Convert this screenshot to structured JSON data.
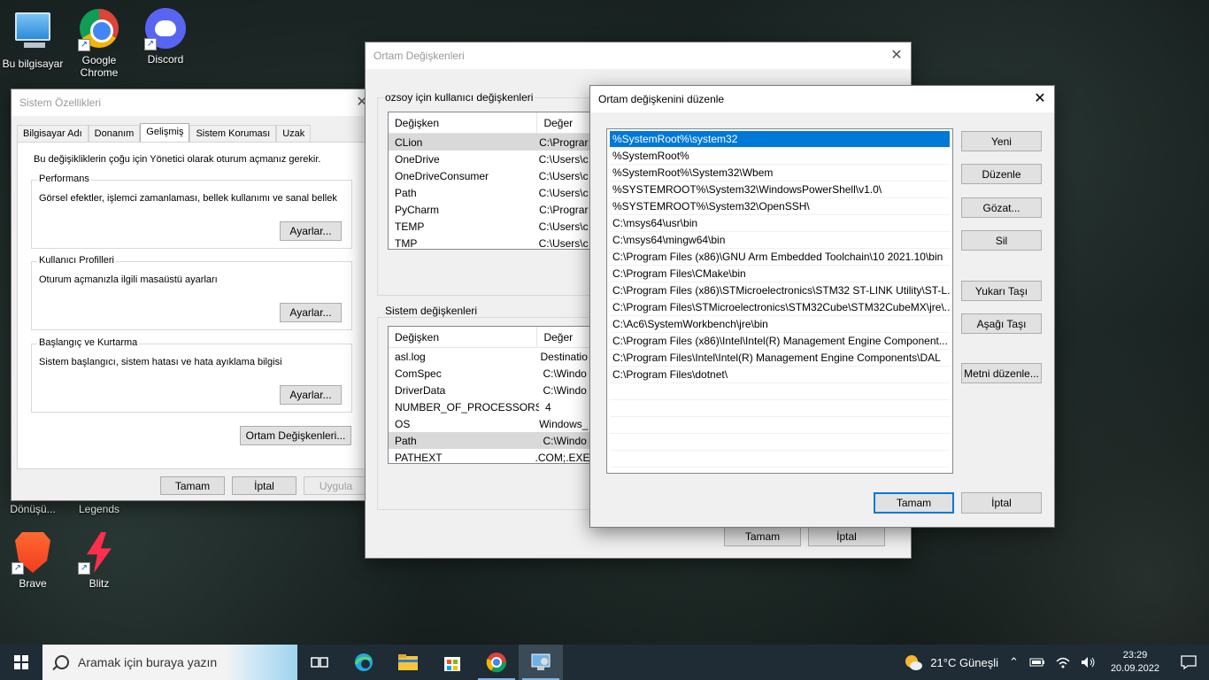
{
  "desktop": {
    "icons": [
      {
        "label": "Bu bilgisayar",
        "icon": "computer-icon"
      },
      {
        "label": "Google Chrome",
        "icon": "chrome-icon"
      },
      {
        "label": "Discord",
        "icon": "discord-icon"
      },
      {
        "label": "Dönüşü...",
        "icon": "app-icon"
      },
      {
        "label": "Legends",
        "icon": "app-icon"
      },
      {
        "label": "Brave",
        "icon": "brave-icon"
      },
      {
        "label": "Blitz",
        "icon": "blitz-icon"
      }
    ]
  },
  "system_properties": {
    "title": "Sistem Özellikleri",
    "tabs": [
      "Bilgisayar Adı",
      "Donanım",
      "Gelişmiş",
      "Sistem Koruması",
      "Uzak"
    ],
    "active_tab": "Gelişmiş",
    "admin_note": "Bu değişikliklerin çoğu için Yönetici olarak oturum açmanız gerekir.",
    "groups": [
      {
        "label": "Performans",
        "text": "Görsel efektler, işlemci zamanlaması, bellek kullanımı ve sanal bellek",
        "button": "Ayarlar..."
      },
      {
        "label": "Kullanıcı Profilleri",
        "text": "Oturum açmanızla ilgili masaüstü ayarları",
        "button": "Ayarlar..."
      },
      {
        "label": "Başlangıç ve Kurtarma",
        "text": "Sistem başlangıcı, sistem hatası ve hata ayıklama bilgisi",
        "button": "Ayarlar..."
      }
    ],
    "env_button": "Ortam Değişkenleri...",
    "ok": "Tamam",
    "cancel": "İptal",
    "apply": "Uygula"
  },
  "env_vars": {
    "title": "Ortam Değişkenleri",
    "user_section": "ozsoy için kullanıcı değişkenleri",
    "system_section": "Sistem değişkenleri",
    "col_var": "Değişken",
    "col_val": "Değer",
    "user_rows": [
      {
        "name": "CLion",
        "value": "C:\\Prograr"
      },
      {
        "name": "OneDrive",
        "value": "C:\\Users\\c"
      },
      {
        "name": "OneDriveConsumer",
        "value": "C:\\Users\\c"
      },
      {
        "name": "Path",
        "value": "C:\\Users\\c"
      },
      {
        "name": "PyCharm",
        "value": "C:\\Prograr"
      },
      {
        "name": "TEMP",
        "value": "C:\\Users\\c"
      },
      {
        "name": "TMP",
        "value": "C:\\Users\\c"
      }
    ],
    "system_rows": [
      {
        "name": "asl.log",
        "value": "Destinatio"
      },
      {
        "name": "ComSpec",
        "value": "C:\\Windo"
      },
      {
        "name": "DriverData",
        "value": "C:\\Windo"
      },
      {
        "name": "NUMBER_OF_PROCESSORS",
        "value": "4"
      },
      {
        "name": "OS",
        "value": "Windows_"
      },
      {
        "name": "Path",
        "value": "C:\\Windo"
      },
      {
        "name": "PATHEXT",
        "value": ".COM;.EXE"
      }
    ],
    "ok": "Tamam",
    "cancel": "İptal"
  },
  "edit_var": {
    "title": "Ortam değişkenini düzenle",
    "paths": [
      "%SystemRoot%\\system32",
      "%SystemRoot%",
      "%SystemRoot%\\System32\\Wbem",
      "%SYSTEMROOT%\\System32\\WindowsPowerShell\\v1.0\\",
      "%SYSTEMROOT%\\System32\\OpenSSH\\",
      "C:\\msys64\\usr\\bin",
      "C:\\msys64\\mingw64\\bin",
      "C:\\Program Files (x86)\\GNU Arm Embedded Toolchain\\10 2021.10\\bin",
      "C:\\Program Files\\CMake\\bin",
      "C:\\Program Files (x86)\\STMicroelectronics\\STM32 ST-LINK Utility\\ST-L...",
      "C:\\Program Files\\STMicroelectronics\\STM32Cube\\STM32CubeMX\\jre\\...",
      "C:\\Ac6\\SystemWorkbench\\jre\\bin",
      "C:\\Program Files (x86)\\Intel\\Intel(R) Management Engine Component...",
      "C:\\Program Files\\Intel\\Intel(R) Management Engine Components\\DAL",
      "C:\\Program Files\\dotnet\\"
    ],
    "buttons": {
      "new": "Yeni",
      "edit": "Düzenle",
      "browse": "Gözat...",
      "delete": "Sil",
      "move_up": "Yukarı Taşı",
      "move_down": "Aşağı Taşı",
      "edit_text": "Metni düzenle..."
    },
    "ok": "Tamam",
    "cancel": "İptal"
  },
  "taskbar": {
    "search_placeholder": "Aramak için buraya yazın",
    "weather": "21°C  Güneşli",
    "time": "23:29",
    "date": "20.09.2022"
  }
}
